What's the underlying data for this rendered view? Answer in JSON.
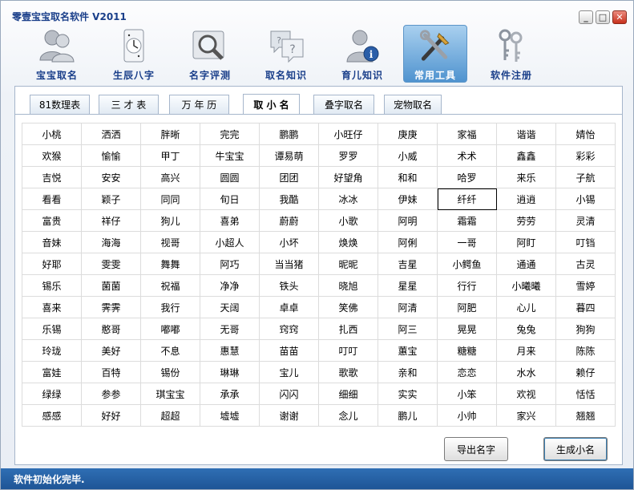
{
  "window": {
    "title": "零壹宝宝取名软件 V2011",
    "min_glyph": "_",
    "max_glyph": "□",
    "close_glyph": "✕"
  },
  "toolbar": {
    "items": [
      {
        "label": "宝宝取名",
        "icon": "users-icon"
      },
      {
        "label": "生辰八字",
        "icon": "clock-icon"
      },
      {
        "label": "名字评测",
        "icon": "magnifier-icon"
      },
      {
        "label": "取名知识",
        "icon": "question-bubbles-icon"
      },
      {
        "label": "育儿知识",
        "icon": "info-user-icon"
      },
      {
        "label": "常用工具",
        "icon": "tools-icon"
      },
      {
        "label": "软件注册",
        "icon": "keys-icon"
      }
    ],
    "active_index": 5
  },
  "tabs": [
    {
      "label": "81数理表"
    },
    {
      "label": "三 才 表"
    },
    {
      "label": "万 年 历"
    },
    {
      "label": "取 小 名"
    },
    {
      "label": "叠字取名"
    },
    {
      "label": "宠物取名"
    }
  ],
  "active_tab": 3,
  "names": [
    [
      "小桃",
      "洒洒",
      "胖晰",
      "完完",
      "鹏鹏",
      "小旺仔",
      "庚庚",
      "家福",
      "谐谐",
      "婧怡"
    ],
    [
      "欢猴",
      "愉愉",
      "甲丁",
      "牛宝宝",
      "谭易萌",
      "罗罗",
      "小威",
      "术术",
      "鑫鑫",
      "彩彩"
    ],
    [
      "吉悦",
      "安安",
      "高兴",
      "圆圆",
      "团团",
      "好望角",
      "和和",
      "哈罗",
      "来乐",
      "子航"
    ],
    [
      "看看",
      "颖子",
      "同同",
      "旬日",
      "我酷",
      "冰冰",
      "伊妹",
      "纤纤",
      "逍逍",
      "小锡"
    ],
    [
      "富贵",
      "祥仔",
      "狗儿",
      "喜弟",
      "蔚蔚",
      "小歌",
      "阿明",
      "霜霜",
      "劳劳",
      "灵清"
    ],
    [
      "音妹",
      "海海",
      "视哥",
      "小超人",
      "小坏",
      "焕焕",
      "阿俐",
      "一哥",
      "阿盯",
      "叮铛"
    ],
    [
      "好耶",
      "雯雯",
      "舞舞",
      "阿巧",
      "当当猪",
      "昵昵",
      "吉星",
      "小鳄鱼",
      "通通",
      "古灵"
    ],
    [
      "锡乐",
      "菌菌",
      "祝福",
      "净净",
      "铁头",
      "晓旭",
      "星星",
      "行行",
      "小曦曦",
      "雪婷"
    ],
    [
      "喜来",
      "霁霁",
      "我行",
      "天阔",
      "卓卓",
      "笑佛",
      "阿清",
      "阿肥",
      "心儿",
      "暮四"
    ],
    [
      "乐锡",
      "憨哥",
      "嘟嘟",
      "无哥",
      "窍窍",
      "扎西",
      "阿三",
      "晃晃",
      "兔兔",
      "狗狗"
    ],
    [
      "玲珑",
      "美好",
      "不息",
      "惠慧",
      "苗苗",
      "叮叮",
      "蕙宝",
      "糖糖",
      "月来",
      "陈陈"
    ],
    [
      "富娃",
      "百特",
      "锡份",
      "琳琳",
      "宝儿",
      "歌歌",
      "亲和",
      "恋恋",
      "水水",
      "赖仔"
    ],
    [
      "绿绿",
      "参参",
      "琪宝宝",
      "承承",
      "闪闪",
      "细细",
      "实实",
      "小笨",
      "欢视",
      "恬恬"
    ],
    [
      "感感",
      "好好",
      "超超",
      "墟墟",
      "谢谢",
      "念儿",
      "鹏儿",
      "小帅",
      "家兴",
      "翘翘"
    ]
  ],
  "selected_cell": {
    "row": 3,
    "col": 7
  },
  "buttons": {
    "export": "导出名字",
    "generate": "生成小名"
  },
  "status": "软件初始化完毕.",
  "colors": {
    "title_text": "#1a3f8a",
    "active_tool_bg": "#4f93cf",
    "statusbar_bg": "#1e5596",
    "close_button": "#c7301c"
  }
}
